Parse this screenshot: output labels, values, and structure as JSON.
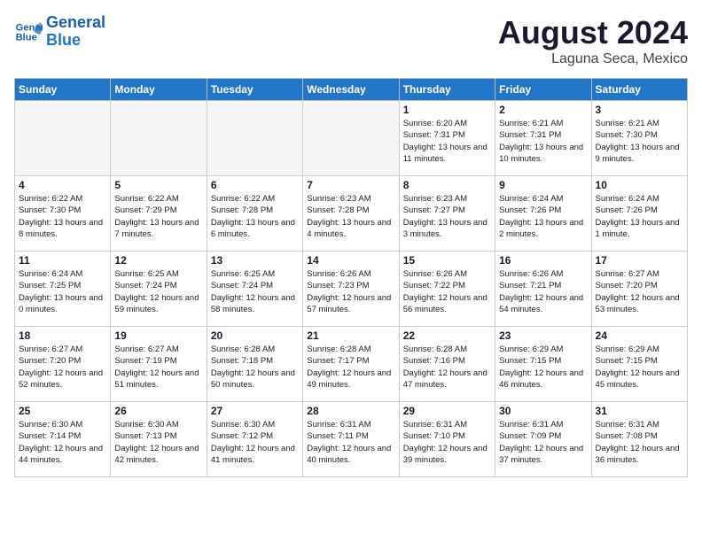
{
  "header": {
    "logo_line1": "General",
    "logo_line2": "Blue",
    "title": "August 2024",
    "subtitle": "Laguna Seca, Mexico"
  },
  "weekdays": [
    "Sunday",
    "Monday",
    "Tuesday",
    "Wednesday",
    "Thursday",
    "Friday",
    "Saturday"
  ],
  "weeks": [
    [
      {
        "day": "",
        "empty": true
      },
      {
        "day": "",
        "empty": true
      },
      {
        "day": "",
        "empty": true
      },
      {
        "day": "",
        "empty": true
      },
      {
        "day": "1",
        "info": "Sunrise: 6:20 AM\nSunset: 7:31 PM\nDaylight: 13 hours\nand 11 minutes."
      },
      {
        "day": "2",
        "info": "Sunrise: 6:21 AM\nSunset: 7:31 PM\nDaylight: 13 hours\nand 10 minutes."
      },
      {
        "day": "3",
        "info": "Sunrise: 6:21 AM\nSunset: 7:30 PM\nDaylight: 13 hours\nand 9 minutes."
      }
    ],
    [
      {
        "day": "4",
        "info": "Sunrise: 6:22 AM\nSunset: 7:30 PM\nDaylight: 13 hours\nand 8 minutes."
      },
      {
        "day": "5",
        "info": "Sunrise: 6:22 AM\nSunset: 7:29 PM\nDaylight: 13 hours\nand 7 minutes."
      },
      {
        "day": "6",
        "info": "Sunrise: 6:22 AM\nSunset: 7:28 PM\nDaylight: 13 hours\nand 6 minutes."
      },
      {
        "day": "7",
        "info": "Sunrise: 6:23 AM\nSunset: 7:28 PM\nDaylight: 13 hours\nand 4 minutes."
      },
      {
        "day": "8",
        "info": "Sunrise: 6:23 AM\nSunset: 7:27 PM\nDaylight: 13 hours\nand 3 minutes."
      },
      {
        "day": "9",
        "info": "Sunrise: 6:24 AM\nSunset: 7:26 PM\nDaylight: 13 hours\nand 2 minutes."
      },
      {
        "day": "10",
        "info": "Sunrise: 6:24 AM\nSunset: 7:26 PM\nDaylight: 13 hours\nand 1 minute."
      }
    ],
    [
      {
        "day": "11",
        "info": "Sunrise: 6:24 AM\nSunset: 7:25 PM\nDaylight: 13 hours\nand 0 minutes."
      },
      {
        "day": "12",
        "info": "Sunrise: 6:25 AM\nSunset: 7:24 PM\nDaylight: 12 hours\nand 59 minutes."
      },
      {
        "day": "13",
        "info": "Sunrise: 6:25 AM\nSunset: 7:24 PM\nDaylight: 12 hours\nand 58 minutes."
      },
      {
        "day": "14",
        "info": "Sunrise: 6:26 AM\nSunset: 7:23 PM\nDaylight: 12 hours\nand 57 minutes."
      },
      {
        "day": "15",
        "info": "Sunrise: 6:26 AM\nSunset: 7:22 PM\nDaylight: 12 hours\nand 56 minutes."
      },
      {
        "day": "16",
        "info": "Sunrise: 6:26 AM\nSunset: 7:21 PM\nDaylight: 12 hours\nand 54 minutes."
      },
      {
        "day": "17",
        "info": "Sunrise: 6:27 AM\nSunset: 7:20 PM\nDaylight: 12 hours\nand 53 minutes."
      }
    ],
    [
      {
        "day": "18",
        "info": "Sunrise: 6:27 AM\nSunset: 7:20 PM\nDaylight: 12 hours\nand 52 minutes."
      },
      {
        "day": "19",
        "info": "Sunrise: 6:27 AM\nSunset: 7:19 PM\nDaylight: 12 hours\nand 51 minutes."
      },
      {
        "day": "20",
        "info": "Sunrise: 6:28 AM\nSunset: 7:18 PM\nDaylight: 12 hours\nand 50 minutes."
      },
      {
        "day": "21",
        "info": "Sunrise: 6:28 AM\nSunset: 7:17 PM\nDaylight: 12 hours\nand 49 minutes."
      },
      {
        "day": "22",
        "info": "Sunrise: 6:28 AM\nSunset: 7:16 PM\nDaylight: 12 hours\nand 47 minutes."
      },
      {
        "day": "23",
        "info": "Sunrise: 6:29 AM\nSunset: 7:15 PM\nDaylight: 12 hours\nand 46 minutes."
      },
      {
        "day": "24",
        "info": "Sunrise: 6:29 AM\nSunset: 7:15 PM\nDaylight: 12 hours\nand 45 minutes."
      }
    ],
    [
      {
        "day": "25",
        "info": "Sunrise: 6:30 AM\nSunset: 7:14 PM\nDaylight: 12 hours\nand 44 minutes."
      },
      {
        "day": "26",
        "info": "Sunrise: 6:30 AM\nSunset: 7:13 PM\nDaylight: 12 hours\nand 42 minutes."
      },
      {
        "day": "27",
        "info": "Sunrise: 6:30 AM\nSunset: 7:12 PM\nDaylight: 12 hours\nand 41 minutes."
      },
      {
        "day": "28",
        "info": "Sunrise: 6:31 AM\nSunset: 7:11 PM\nDaylight: 12 hours\nand 40 minutes."
      },
      {
        "day": "29",
        "info": "Sunrise: 6:31 AM\nSunset: 7:10 PM\nDaylight: 12 hours\nand 39 minutes."
      },
      {
        "day": "30",
        "info": "Sunrise: 6:31 AM\nSunset: 7:09 PM\nDaylight: 12 hours\nand 37 minutes."
      },
      {
        "day": "31",
        "info": "Sunrise: 6:31 AM\nSunset: 7:08 PM\nDaylight: 12 hours\nand 36 minutes."
      }
    ]
  ]
}
